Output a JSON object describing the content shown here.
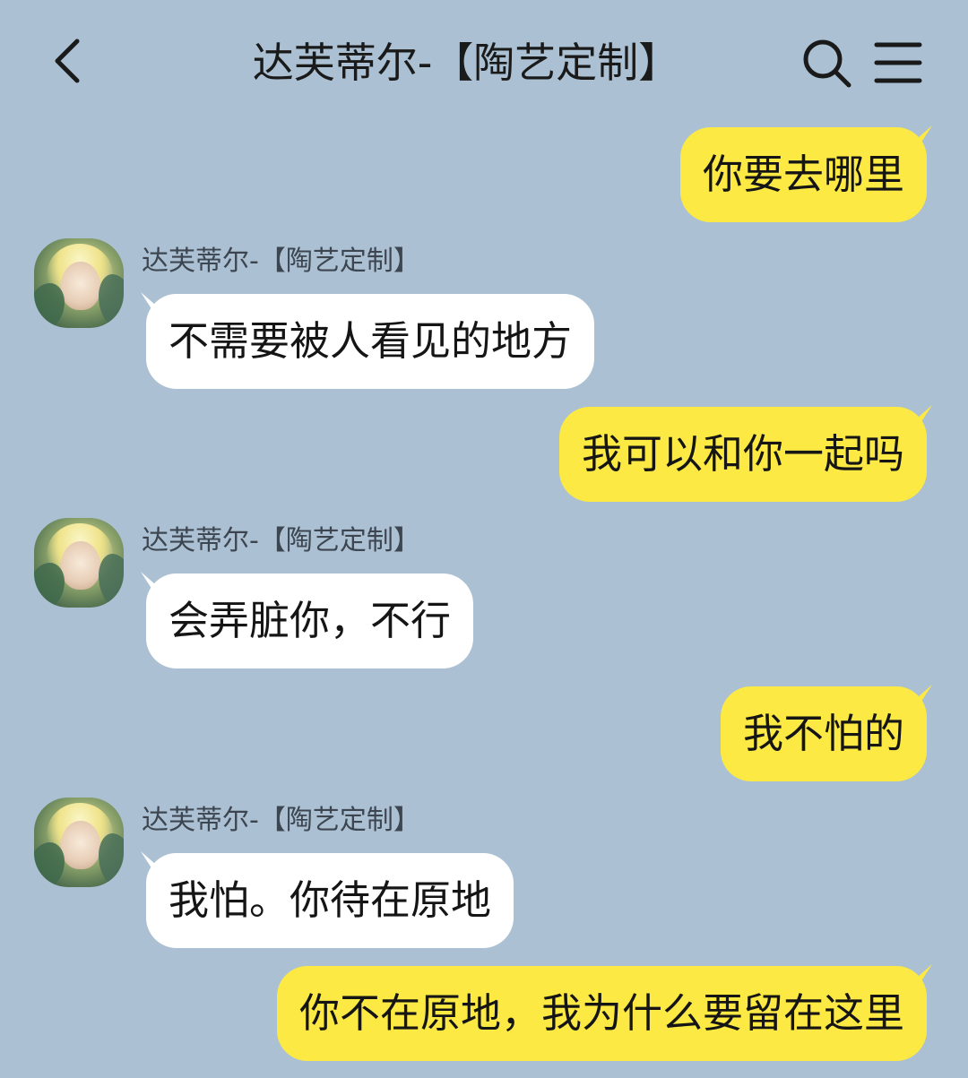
{
  "header": {
    "title": "达芙蒂尔-【陶艺定制】",
    "back_icon": "chevron-left-icon",
    "search_icon": "search-icon",
    "menu_icon": "menu-icon"
  },
  "colors": {
    "background": "#abc1d3",
    "outgoing_bubble": "#fce943",
    "incoming_bubble": "#ffffff"
  },
  "messages": [
    {
      "direction": "out",
      "text": "你要去哪里"
    },
    {
      "direction": "in",
      "sender": "达芙蒂尔-【陶艺定制】",
      "text": "不需要被人看见的地方"
    },
    {
      "direction": "out",
      "text": "我可以和你一起吗"
    },
    {
      "direction": "in",
      "sender": "达芙蒂尔-【陶艺定制】",
      "text": "会弄脏你，不行"
    },
    {
      "direction": "out",
      "text": "我不怕的"
    },
    {
      "direction": "in",
      "sender": "达芙蒂尔-【陶艺定制】",
      "text": "我怕。你待在原地"
    },
    {
      "direction": "out",
      "text": "你不在原地，我为什么要留在这里"
    }
  ]
}
